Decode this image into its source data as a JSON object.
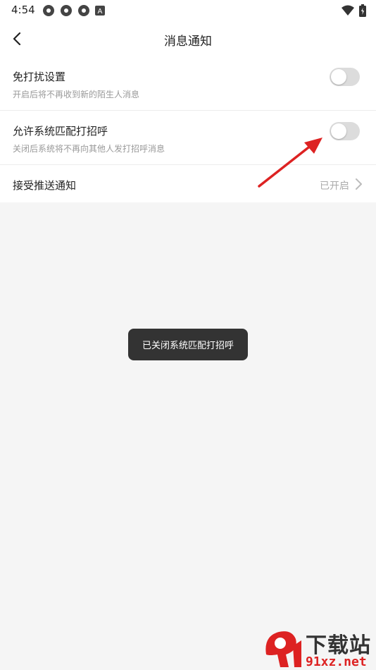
{
  "status_bar": {
    "time": "4:54",
    "icons": [
      "aperture-icon",
      "aperture-icon",
      "aperture-icon",
      "a-box-icon"
    ],
    "right_icons": [
      "wifi-icon",
      "battery-charging-icon"
    ]
  },
  "header": {
    "title": "消息通知",
    "back_icon": "chevron-left-icon"
  },
  "settings": {
    "items": [
      {
        "title": "免打扰设置",
        "subtitle": "开启后将不再收到新的陌生人消息",
        "toggle_on": false
      },
      {
        "title": "允许系统匹配打招呼",
        "subtitle": "关闭后系统将不再向其他人发打招呼消息",
        "toggle_on": false
      },
      {
        "title": "接受推送通知",
        "value": "已开启",
        "icon": "chevron-right-icon"
      }
    ]
  },
  "toast": {
    "text": "已关闭系统匹配打招呼"
  },
  "annotation": {
    "icon": "red-arrow-icon",
    "color": "#dd2222"
  },
  "watermark": {
    "logo_icon": "91-logo-icon",
    "text_top": "下载站",
    "text_bottom": "91xz.net",
    "colors": {
      "red": "#dd2222",
      "dark": "#333333"
    }
  },
  "colors": {
    "toggle_off": "#dcdcdc",
    "toast_bg": "#333333",
    "page_bg": "#f5f5f5"
  }
}
